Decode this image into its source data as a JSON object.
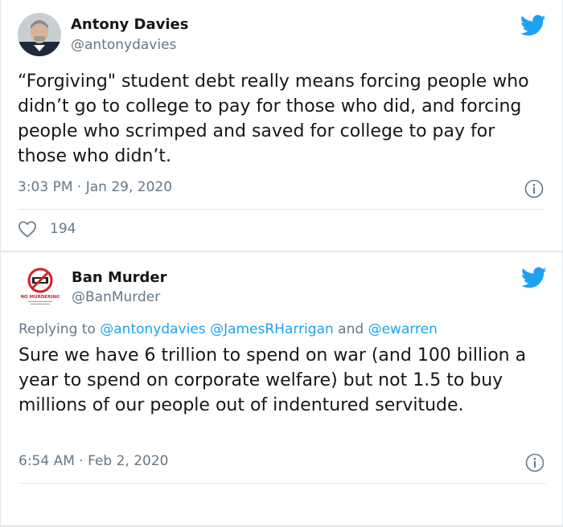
{
  "tweet1": {
    "author_name": "Antony Davies",
    "author_handle": "@antonydavies",
    "text": "“Forgiving\" student debt really means forcing people who didn’t go to college to pay for those who did, and forcing people who scrimped and saved for college to pay for those who didn’t.",
    "timestamp": "3:03 PM · Jan 29, 2020",
    "like_count": "194",
    "icons": {
      "platform": "twitter-bird-icon",
      "info": "info-icon",
      "like": "heart-icon"
    }
  },
  "tweet2": {
    "author_name": "Ban Murder",
    "author_handle": "@BanMurder",
    "replying_prefix": "Replying to ",
    "replying_to": [
      "@antonydavies",
      "@JamesRHarrigan",
      "@ewarren"
    ],
    "replying_and": " and ",
    "avatar_caption": "NO MURDERING",
    "text": "Sure we have 6 trillion to spend on war (and 100 billion a year to spend on corporate welfare) but not 1.5 to buy millions of our people out of indentured servitude.",
    "timestamp": "6:54 AM · Feb 2, 2020",
    "icons": {
      "platform": "twitter-bird-icon",
      "info": "info-icon"
    }
  },
  "colors": {
    "brand_blue": "#1da1f2",
    "text_primary": "#14171a",
    "text_secondary": "#657786",
    "divider": "#e1e8ed"
  }
}
